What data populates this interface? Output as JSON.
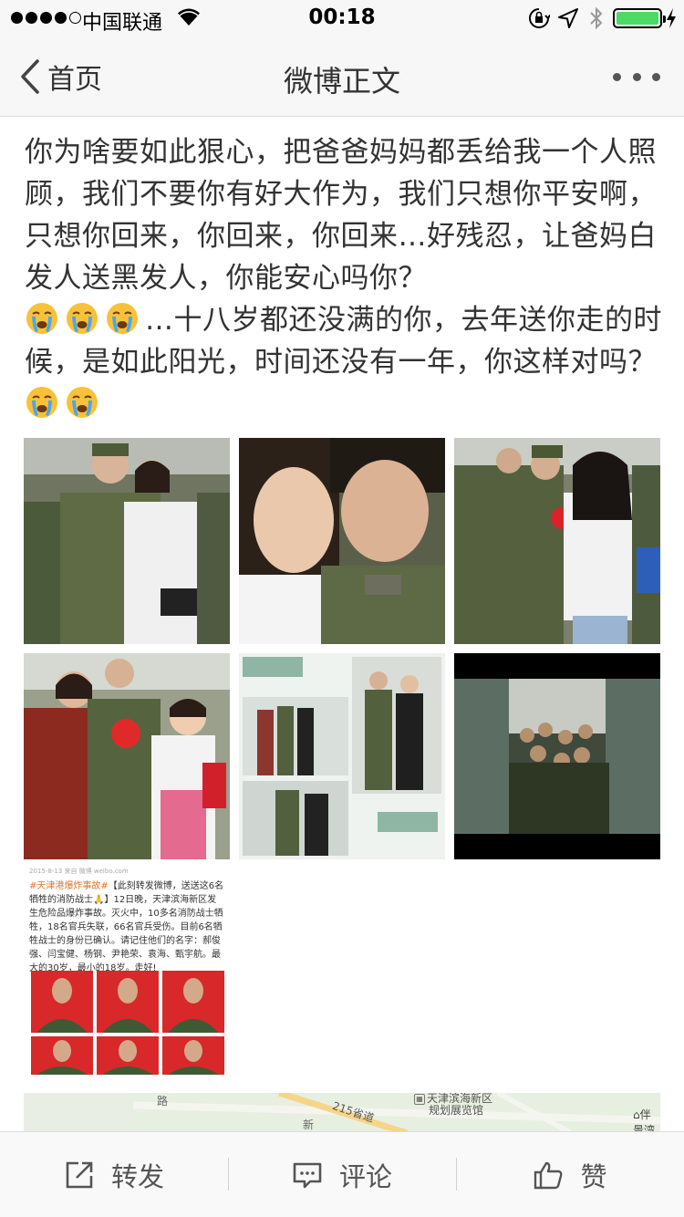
{
  "status_bar": {
    "carrier": "中国联通",
    "time": "00:18",
    "signal_bars": 4,
    "battery_level": 1.0,
    "battery_color": "#4cd964"
  },
  "nav": {
    "back_label": "首页",
    "title": "微博正文",
    "back_icon": "chevron-left-icon",
    "more_icon": "more-dots-icon"
  },
  "post": {
    "text_1": "你为啥要如此狠心，把爸爸妈妈都丢给我一个人照顾，我们不要你有好大作为，我们只想你平安啊，只想你回来，你回来，你回来…好残忍，让爸妈白发人送黑发人，你能安心吗你？",
    "text_2": "…十八岁都还没满的你，去年送你走的时候，是如此阳光，时间还没有一年，你这样对吗？",
    "emoji_icon": "crying-face-icon"
  },
  "news_screenshot": {
    "top_line": "2015-8-13 来自 微博 weibo.com",
    "tag": "#天津港爆炸事故#",
    "body": "【此刻转发微博，送送这6名牺牲的消防战士🙏】12日晚，天津滨海新区发生危险品爆炸事故。灭火中，10多名消防战士牺牲，18名官兵失联，66名官兵受伤。目前6名牺牲战士的身份已确认。请记住他们的名字：郝俊强、闫宝健、杨钢、尹艳荣、袁海、甄宇航。最大的30岁，最小的18岁。走好!"
  },
  "map": {
    "poi_line1": "天津滨海新区",
    "poi_line2": "规划展览馆",
    "road": "215省道",
    "right_poi": "伴景湾",
    "left_label1": "路",
    "left_label2": "新"
  },
  "toolbar": {
    "repost_label": "转发",
    "comment_label": "评论",
    "like_label": "赞"
  }
}
